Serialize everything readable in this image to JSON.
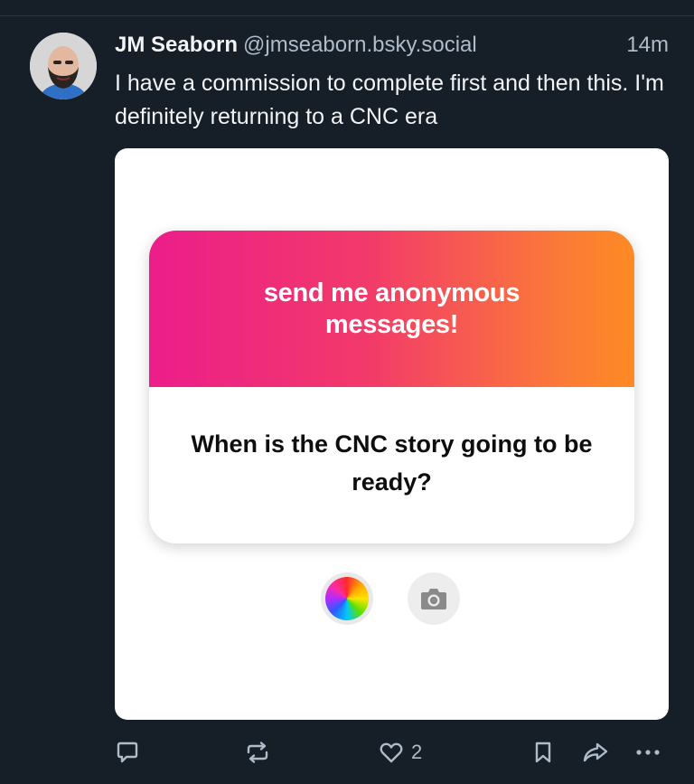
{
  "post": {
    "author_name": "JM Seaborn",
    "handle": "@jmseaborn.bsky.social",
    "timestamp": "14m",
    "text": "I have a commission to complete first and then this. I'm definitely returning to a CNC era"
  },
  "embed": {
    "heading": "send me anonymous messages!",
    "question": "When is the CNC story going to be ready?"
  },
  "actions": {
    "reply_icon": "reply-icon",
    "repost_icon": "repost-icon",
    "like_icon": "heart-icon",
    "like_count": "2",
    "bookmark_icon": "bookmark-icon",
    "share_icon": "share-icon",
    "more_icon": "more-icon"
  },
  "colors": {
    "background": "#161e27",
    "secondary_text": "#aebbc9",
    "gradient_start": "#ec1d8a",
    "gradient_end": "#fd8a23"
  }
}
